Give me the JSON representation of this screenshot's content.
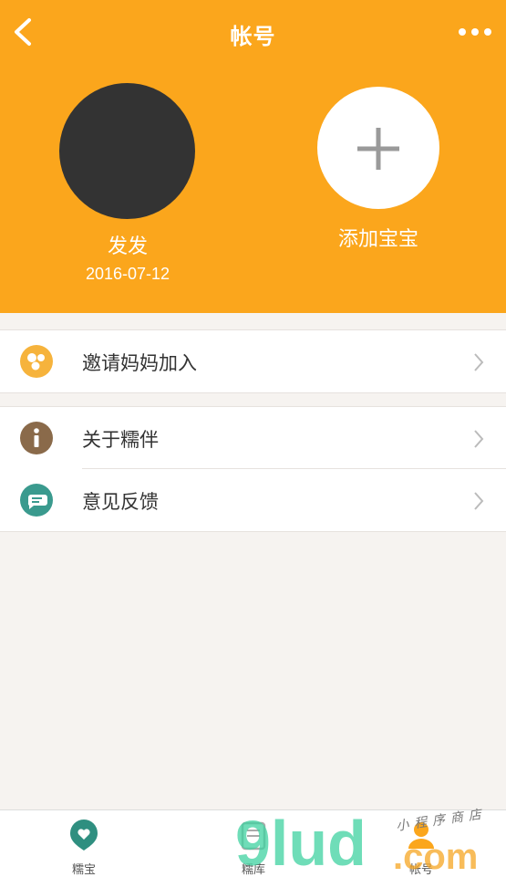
{
  "header": {
    "title": "帐号",
    "baby": {
      "name": "发发",
      "birthdate": "2016-07-12"
    },
    "add_baby_label": "添加宝宝"
  },
  "menu": {
    "group1": [
      {
        "label": "邀请妈妈加入",
        "icon": "invite-icon"
      }
    ],
    "group2": [
      {
        "label": "关于糯伴",
        "icon": "info-icon"
      },
      {
        "label": "意见反馈",
        "icon": "feedback-icon"
      }
    ]
  },
  "tabbar": {
    "tabs": [
      {
        "label": "糯宝",
        "icon": "heart-pin-icon"
      },
      {
        "label": "糯库",
        "icon": "library-icon"
      },
      {
        "label": "帐号",
        "icon": "account-icon"
      }
    ]
  },
  "watermark": {
    "brand": "9lud.com",
    "sub": "小程序商店"
  },
  "colors": {
    "accent": "#fba61c",
    "invite": "#f6b33c",
    "info": "#8a6a4a",
    "feedback": "#3a9a8e",
    "tab_active": "#2f8f80"
  }
}
